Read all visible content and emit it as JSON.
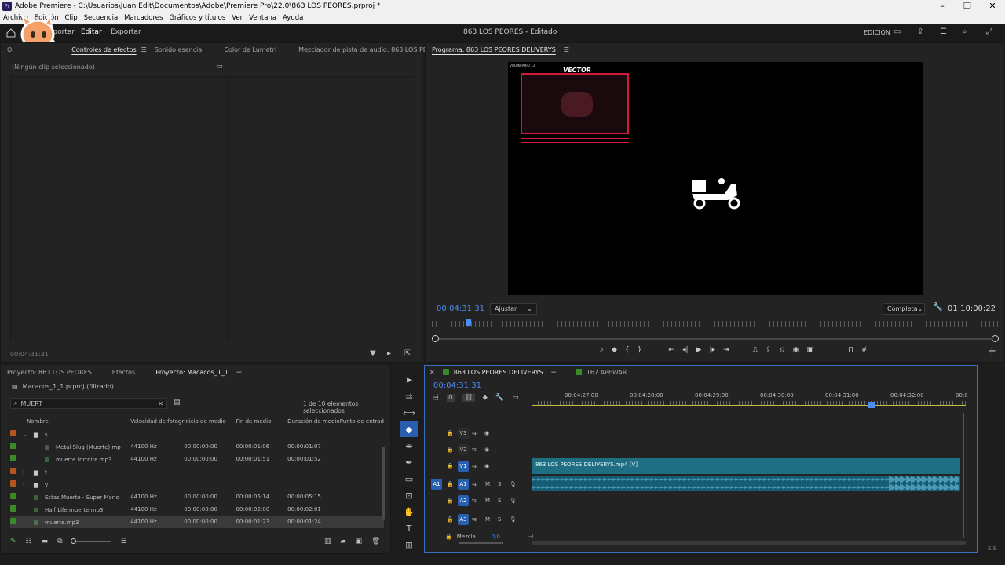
{
  "titlebar": {
    "app_icon": "Pr",
    "title": "Adobe Premiere - C:\\Usuarios\\Juan Edit\\Documentos\\Adobe\\Premiere Pro\\22.0\\863 LOS PEORES.prproj *",
    "minimize": "–",
    "maximize": "❐",
    "close": "✕"
  },
  "menu": [
    "Archivo",
    "Edición",
    "Clip",
    "Secuencia",
    "Marcadores",
    "Gráficos y títulos",
    "Ver",
    "Ventana",
    "Ayuda"
  ],
  "appbar": {
    "import": "Importar",
    "edit": "Editar",
    "export": "Exportar",
    "project_title": "863 LOS PEORES - Editado",
    "workspace": "EDICIÓN"
  },
  "source_panel": {
    "tabs": [
      "O",
      "Controles de efectos",
      "Sonido esencial",
      "Color de Lumetri",
      "Mezclador de pista de audio: 863 LOS PEORES DELIVE"
    ],
    "no_clip": "(Ningún clip seleccionado)",
    "timecode": "00:04:31:31"
  },
  "program": {
    "tab": "Programa: 863 LOS PEORES DELIVERYS",
    "timecode": "00:04:31:31",
    "fit": "Ajustar",
    "quality": "Completa",
    "duration": "01:10:00:22",
    "overlay_brand": "VECTOR",
    "overlay_small": "VOLUNTARIO 13"
  },
  "project": {
    "tabs": [
      "Proyecto: 863 LOS PEORES",
      "Efectos",
      "Proyecto: Macacos_1_1"
    ],
    "path": "Macacos_1_1.prproj (filtrado)",
    "search": "MUERT",
    "selection": "1 de 10 elementos seleccionados",
    "columns": [
      "Nombre",
      "Velocidad de fotogr",
      "Inicio de medio",
      "Fin de medio",
      "Duración de medio",
      "Punto de entrad"
    ],
    "rows": [
      {
        "color": "#b5541b",
        "indent": 1,
        "expand": "⌄",
        "folder": true,
        "name": "s",
        "fps": "",
        "start": "",
        "end": "",
        "dur": ""
      },
      {
        "color": "#3a8a2a",
        "indent": 2,
        "expand": "",
        "folder": false,
        "name": "Metal Slug (Muerte).mp",
        "fps": "44100 Hz",
        "start": "00:00:00:00",
        "end": "00:00:01:06",
        "dur": "00:00:01:07"
      },
      {
        "color": "#3a8a2a",
        "indent": 2,
        "expand": "",
        "folder": false,
        "name": "muerte fortnite.mp3",
        "fps": "44100 Hz",
        "start": "00:00:00:00",
        "end": "00:00:01:51",
        "dur": "00:00:01:52"
      },
      {
        "color": "#b5541b",
        "indent": 1,
        "expand": "›",
        "folder": true,
        "name": "t",
        "fps": "",
        "start": "",
        "end": "",
        "dur": ""
      },
      {
        "color": "#b5541b",
        "indent": 1,
        "expand": "›",
        "folder": true,
        "name": "v",
        "fps": "",
        "start": "",
        "end": "",
        "dur": ""
      },
      {
        "color": "#3a8a2a",
        "indent": 1,
        "expand": "",
        "folder": false,
        "name": "Estas Muerto - Super Mario",
        "fps": "44100 Hz",
        "start": "00:00:00:00",
        "end": "00:00:05:14",
        "dur": "00:00:05:15"
      },
      {
        "color": "#3a8a2a",
        "indent": 1,
        "expand": "",
        "folder": false,
        "name": "Half Life muerte.mp3",
        "fps": "44100 Hz",
        "start": "00:00:00:00",
        "end": "00:00:02:00",
        "dur": "00:00:02:01"
      },
      {
        "color": "#3a8a2a",
        "indent": 1,
        "expand": "",
        "folder": false,
        "name": "muerte.mp3",
        "fps": "44100 Hz",
        "start": "00:00:00:00",
        "end": "00:00:01:23",
        "dur": "00:00:01:24"
      }
    ]
  },
  "timeline": {
    "tabs": [
      "863 LOS PEORES DELIVERYS",
      "167 APEWAR"
    ],
    "timecode": "00:04:31:31",
    "ruler": [
      "00:04:27:00",
      "00:04:28:00",
      "00:04:29:00",
      "00:04:30:00",
      "00:04:31:00",
      "00:04:32:00",
      "00:0"
    ],
    "tracks": [
      {
        "source": "",
        "name": "V3",
        "kind": "video"
      },
      {
        "source": "",
        "name": "V2",
        "kind": "video"
      },
      {
        "source": "",
        "name": "V1",
        "kind": "video"
      },
      {
        "source": "A1",
        "name": "A1",
        "kind": "audio"
      },
      {
        "source": "",
        "name": "A2",
        "kind": "audio"
      },
      {
        "source": "",
        "name": "A3",
        "kind": "audio"
      }
    ],
    "mute": "M",
    "solo": "S",
    "clip_name": "863 LOS PEORES DELIVERYS.mp4 [V]",
    "mix_label": "Mezcla",
    "mix_value": "0,0",
    "meter_labels": "S S"
  },
  "colors": {
    "accent": "#4c8cf5",
    "clip": "#1e6e84",
    "audio": "#155d74"
  }
}
